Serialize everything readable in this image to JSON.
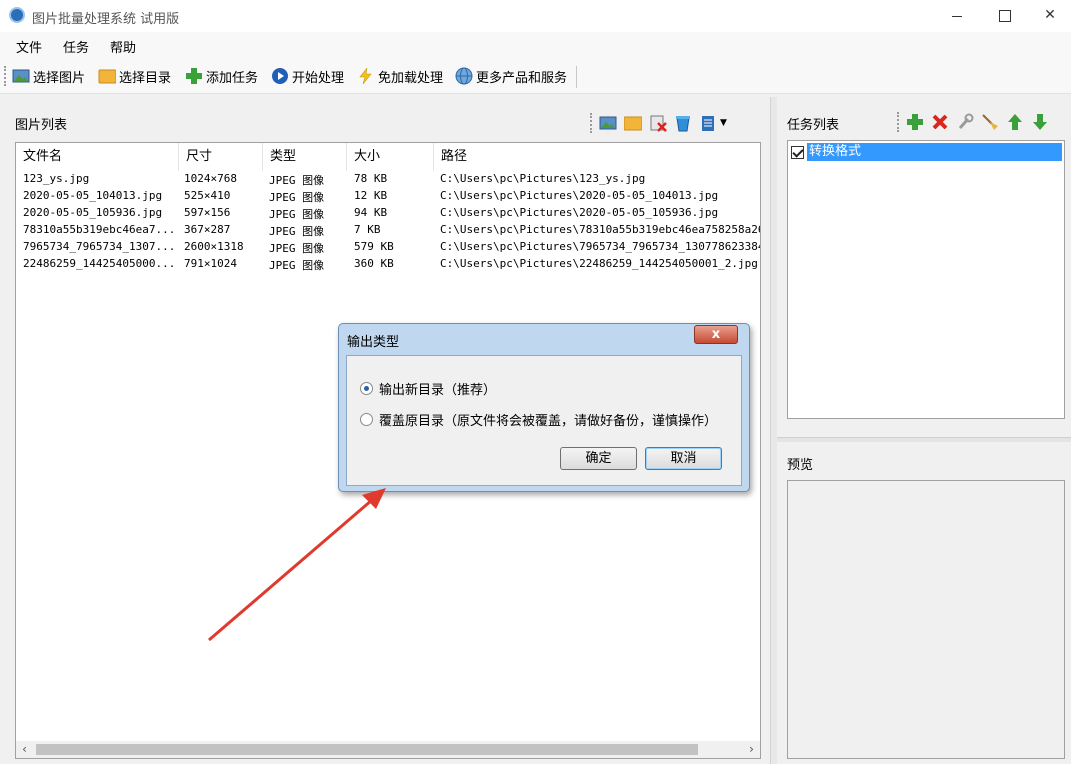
{
  "window": {
    "title": "图片批量处理系统 试用版"
  },
  "menu": [
    "文件",
    "任务",
    "帮助"
  ],
  "toolbar": {
    "select_images": "选择图片",
    "select_folder": "选择目录",
    "add_task": "添加任务",
    "start": "开始处理",
    "no_load": "免加载处理",
    "more": "更多产品和服务"
  },
  "left": {
    "title": "图片列表",
    "columns": [
      "文件名",
      "尺寸",
      "类型",
      "大小",
      "路径"
    ],
    "rows": [
      [
        "123_ys.jpg",
        "1024×768",
        "JPEG 图像",
        "78 KB",
        "C:\\Users\\pc\\Pictures\\123_ys.jpg"
      ],
      [
        "2020-05-05_104013.jpg",
        "525×410",
        "JPEG 图像",
        "12 KB",
        "C:\\Users\\pc\\Pictures\\2020-05-05_104013.jpg"
      ],
      [
        "2020-05-05_105936.jpg",
        "597×156",
        "JPEG 图像",
        "94 KB",
        "C:\\Users\\pc\\Pictures\\2020-05-05_105936.jpg"
      ],
      [
        "78310a55b319ebc46ea7...",
        "367×287",
        "JPEG 图像",
        "7 KB",
        "C:\\Users\\pc\\Pictures\\78310a55b319ebc46ea758258a26c"
      ],
      [
        "7965734_7965734_1307...",
        "2600×1318",
        "JPEG 图像",
        "579 KB",
        "C:\\Users\\pc\\Pictures\\7965734_7965734_1307786233847"
      ],
      [
        "22486259_14425405000...",
        "791×1024",
        "JPEG 图像",
        "360 KB",
        "C:\\Users\\pc\\Pictures\\22486259_144254050001_2.jpg"
      ]
    ]
  },
  "right": {
    "tasks_title": "任务列表",
    "tasks": [
      {
        "label": "转换格式",
        "checked": true
      }
    ],
    "preview_title": "预览"
  },
  "dialog": {
    "title": "输出类型",
    "close": "x",
    "option1": "输出新目录（推荐）",
    "option2": "覆盖原目录（原文件将会被覆盖，请做好备份，谨慎操作）",
    "ok": "确定",
    "cancel": "取消"
  },
  "colors": {
    "accent": "#3399ff",
    "arrow": "#e03a2f"
  }
}
